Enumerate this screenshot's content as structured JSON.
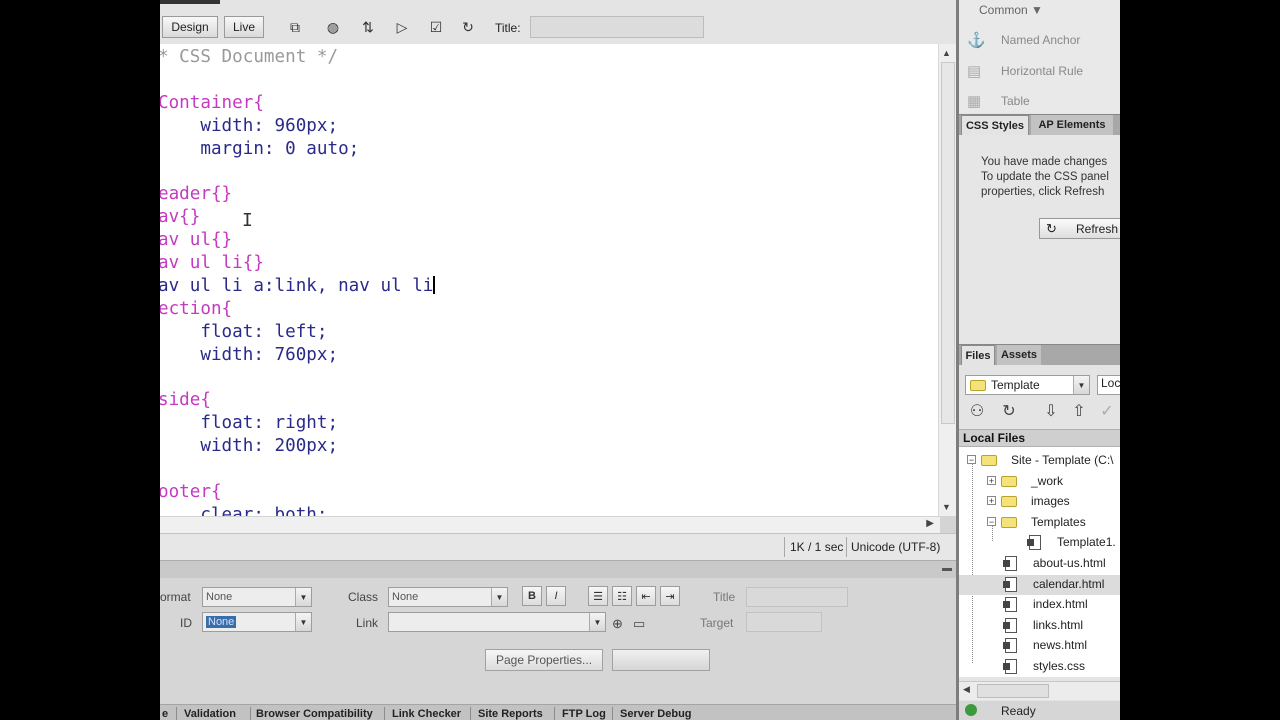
{
  "toolbar": {
    "design_label": "Design",
    "live_label": "Live",
    "title_label": "Title:",
    "title_value": "",
    "icons": [
      "multiscreen-icon",
      "preview-icon",
      "file-management-icon",
      "validate-icon",
      "check-browser-icon",
      "refresh-icon"
    ]
  },
  "code": {
    "lines": [
      [
        {
          "t": "* CSS Document */",
          "c": "comment"
        }
      ],
      [],
      [
        {
          "t": "Container{",
          "c": "sel"
        }
      ],
      [
        {
          "t": "    width: 960px;",
          "c": "prop"
        }
      ],
      [
        {
          "t": "    margin: 0 auto;",
          "c": "prop"
        }
      ],
      [],
      [
        {
          "t": "eader{}",
          "c": "sel"
        }
      ],
      [
        {
          "t": "av{}",
          "c": "sel"
        }
      ],
      [
        {
          "t": "av ul{}",
          "c": "sel"
        }
      ],
      [
        {
          "t": "av ul li{}",
          "c": "sel"
        }
      ],
      [
        {
          "t": "av ul li a:link, nav ul li",
          "c": "prop",
          "caret": true
        }
      ],
      [
        {
          "t": "ection{",
          "c": "sel"
        }
      ],
      [
        {
          "t": "    float: left;",
          "c": "prop"
        }
      ],
      [
        {
          "t": "    width: 760px;",
          "c": "prop"
        }
      ],
      [],
      [
        {
          "t": "side{",
          "c": "sel"
        }
      ],
      [
        {
          "t": "    float: right;",
          "c": "prop"
        }
      ],
      [
        {
          "t": "    width: 200px;",
          "c": "prop"
        }
      ],
      [],
      [
        {
          "t": "ooter{",
          "c": "sel"
        }
      ],
      [
        {
          "t": "    clear: both;",
          "c": "prop"
        }
      ]
    ]
  },
  "status": {
    "size": "1K / 1 sec",
    "encoding": "Unicode (UTF-8)"
  },
  "properties": {
    "format_label": "ormat",
    "format_value": "None",
    "id_label": "ID",
    "id_value": "None",
    "class_label": "Class",
    "class_value": "None",
    "link_label": "Link",
    "link_value": "",
    "bold_label": "B",
    "italic_label": "I",
    "title_label": "Title",
    "target_label": "Target",
    "page_properties_label": "Page Properties...",
    "list_buttons": [
      "unordered-list-icon",
      "ordered-list-icon",
      "outdent-icon",
      "indent-icon"
    ]
  },
  "results": {
    "tabs": [
      "e",
      "Validation",
      "Browser Compatibility",
      "Link Checker",
      "Site Reports",
      "FTP Log",
      "Server Debug"
    ]
  },
  "insert_panel": {
    "category": "Common",
    "items": [
      {
        "label": "Named Anchor",
        "icon": "anchor-icon"
      },
      {
        "label": "Horizontal Rule",
        "icon": "horizontal-rule-icon"
      },
      {
        "label": "Table",
        "icon": "table-icon"
      }
    ]
  },
  "css_panel": {
    "tabs": [
      "CSS Styles",
      "AP Elements"
    ],
    "message_lines": [
      "You have made changes",
      "To update the CSS panel",
      "properties, click Refresh"
    ],
    "refresh_label": "Refresh"
  },
  "files_panel": {
    "tabs": [
      "Files",
      "Assets"
    ],
    "site": "Template",
    "view": "Loc",
    "local_files_label": "Local Files",
    "tree": [
      {
        "label": "Site - Template (C:\\",
        "type": "site",
        "level": 0,
        "toggle": "−"
      },
      {
        "label": "_work",
        "type": "folder",
        "level": 1,
        "toggle": "+"
      },
      {
        "label": "images",
        "type": "folder",
        "level": 1,
        "toggle": "+"
      },
      {
        "label": "Templates",
        "type": "folder",
        "level": 1,
        "toggle": "−"
      },
      {
        "label": "Template1.",
        "type": "file",
        "level": 2
      },
      {
        "label": "about-us.html",
        "type": "file",
        "level": 1
      },
      {
        "label": "calendar.html",
        "type": "file",
        "level": 1,
        "selected": true
      },
      {
        "label": "index.html",
        "type": "file",
        "level": 1
      },
      {
        "label": "links.html",
        "type": "file",
        "level": 1
      },
      {
        "label": "news.html",
        "type": "file",
        "level": 1
      },
      {
        "label": "styles.css",
        "type": "file",
        "level": 1
      }
    ],
    "status": "Ready"
  }
}
